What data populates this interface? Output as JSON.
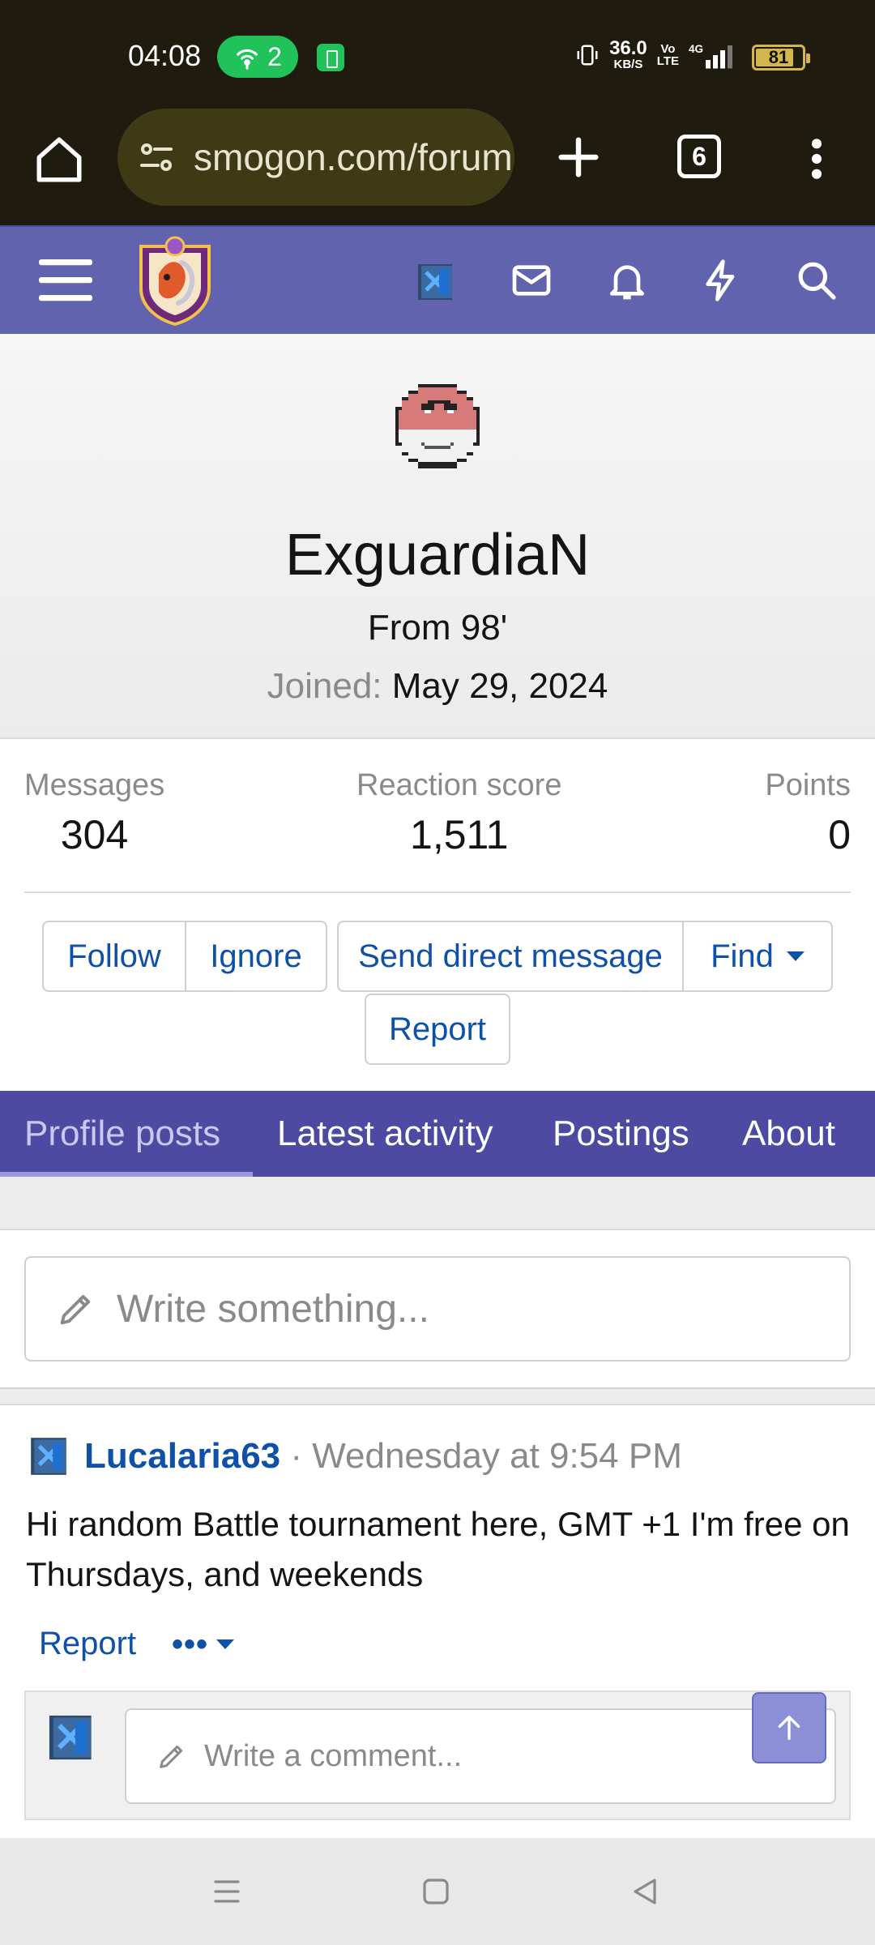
{
  "status_bar": {
    "time": "04:08",
    "hotspot_count": "2",
    "net_speed_value": "36.0",
    "net_speed_unit": "KB/S",
    "volte_top": "Vo",
    "volte_bottom": "LTE",
    "network": "4G",
    "battery_level": "81"
  },
  "browser": {
    "url": "smogon.com/forums/members/exguardian",
    "tab_count": "6"
  },
  "profile": {
    "username": "ExguardiaN",
    "location": "From 98'",
    "joined_label": "Joined:",
    "joined_value": "May 29, 2024"
  },
  "stats": {
    "messages_label": "Messages",
    "messages_value": "304",
    "reaction_label": "Reaction score",
    "reaction_value": "1,511",
    "points_label": "Points",
    "points_value": "0"
  },
  "actions": {
    "follow": "Follow",
    "ignore": "Ignore",
    "send_dm": "Send direct message",
    "find": "Find",
    "report": "Report"
  },
  "tabs": {
    "profile_posts": "Profile posts",
    "latest_activity": "Latest activity",
    "postings": "Postings",
    "about": "About"
  },
  "composer": {
    "placeholder": "Write something..."
  },
  "post": {
    "author": "Lucalaria63",
    "separator": "·",
    "time": "Wednesday at 9:54 PM",
    "body": "Hi random Battle tournament here, GMT +1 I'm free on Thursdays, and weekends",
    "report": "Report",
    "more": "•••"
  },
  "comment": {
    "placeholder": "Write a comment..."
  },
  "colors": {
    "header": "#6163ae",
    "tabs": "#4e4aa1",
    "link": "#0f51a8",
    "browser_bg": "#1f1b0e"
  }
}
